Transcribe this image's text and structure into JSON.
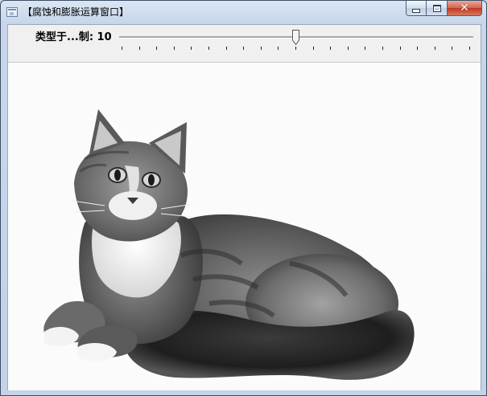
{
  "window": {
    "title": "【腐蚀和膨胀运算窗口】",
    "controls": {
      "minimize": "minimize-icon",
      "maximize": "maximize-icon",
      "close": "close-icon"
    }
  },
  "trackbar": {
    "label": "类型于...制: 10",
    "value": 10,
    "max": 20,
    "tick_count": 21
  },
  "image": {
    "description_icon": "cat-photo",
    "tone": "grayscale"
  },
  "colors": {
    "title_bg": "#c7d6ea",
    "close_btn": "#c0381f",
    "client_bg": "#f0f0f0"
  }
}
